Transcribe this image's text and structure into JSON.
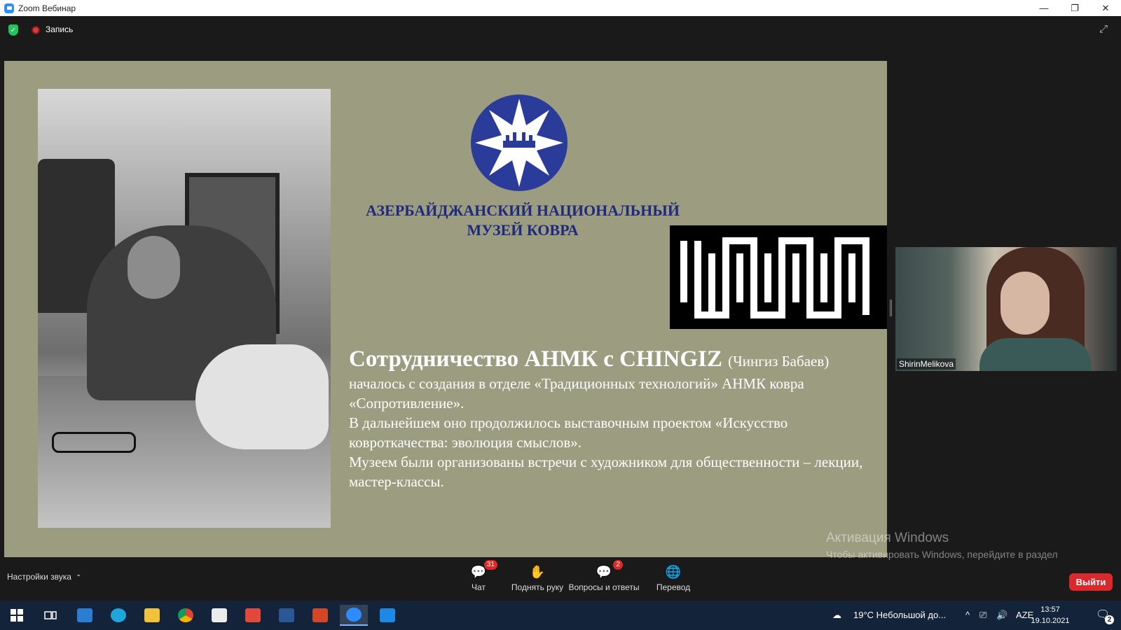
{
  "window": {
    "title": "Zoom Вебинар",
    "minimize": "—",
    "maximize": "❐",
    "close": "✕"
  },
  "topbar": {
    "recording_label": "Запись"
  },
  "slide": {
    "museum_name_line1": "АЗЕРБАЙДЖАНСКИЙ НАЦИОНАЛЬНЫЙ",
    "museum_name_line2": "МУЗЕЙ КОВРА",
    "heading": "Сотрудничество АНМК с CHINGIZ",
    "heading_aside": "(Чингиз Бабаев)",
    "paragraph1": "началось с создания в отделе «Традиционных технологий» АНМК ковра «Сопротивление».",
    "paragraph2": "В дальнейшем оно продолжилось выставочным  проектом «Искусство ковроткачества: эволюция смыслов».",
    "paragraph3": "Музеем были организованы встречи с художником для общественности – лекции, мастер-классы.",
    "emblem_color": "#2a3b9a",
    "background_color": "#9c9c80"
  },
  "video": {
    "participant_name": "ShirinMelikova"
  },
  "watermark": {
    "title": "Активация Windows",
    "subtitle": "Чтобы активировать Windows, перейдите в раздел \"Параметры\"."
  },
  "toolbar": {
    "audio_settings": "Настройки звука",
    "chat_label": "Чат",
    "chat_badge": "31",
    "raise_hand_label": "Поднять руку",
    "qa_label": "Вопросы и ответы",
    "qa_badge": "2",
    "translate_label": "Перевод",
    "leave_label": "Выйти"
  },
  "taskbar": {
    "weather": "19°C  Небольшой до...",
    "language": "AZE",
    "time": "13:57",
    "date": "19.10.2021",
    "notifications_count": "2"
  }
}
